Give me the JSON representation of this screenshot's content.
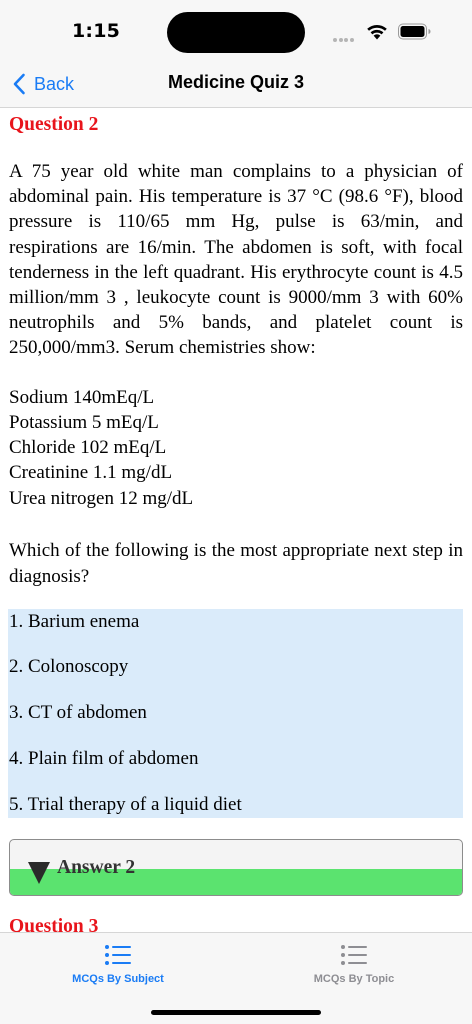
{
  "status_bar": {
    "time": "1:15"
  },
  "nav": {
    "back_label": "Back",
    "title": "Medicine Quiz 3"
  },
  "question": {
    "heading": "Question 2",
    "body": "A 75 year old white man complains to a physician of abdominal pain. His temperature is 37 °C (98.6 °F), blood pressure is 110/65 mm Hg, pulse is 63/min, and respirations are 16/min. The abdomen is soft, with focal tenderness in the left quadrant. His erythrocyte count is 4.5 million/mm 3 , leukocyte count is 9000/mm 3 with 60% neutrophils and 5% bands, and platelet count is 250,000/mm3. Serum chemistries show:",
    "labs": [
      "Sodium 140mEq/L",
      "Potassium 5 mEq/L",
      "Chloride 102 mEq/L",
      "Creatinine 1.1 mg/dL",
      "Urea nitrogen 12 mg/dL"
    ],
    "prompt": "Which of the following is the most appropriate next step in diagnosis?",
    "options": [
      "1. Barium enema",
      "2. Colonoscopy",
      "3. CT of abdomen",
      "4. Plain film of abdomen",
      "5. Trial therapy of a liquid diet"
    ],
    "answer_label": "Answer 2"
  },
  "next_question": {
    "heading": "Question 3"
  },
  "tabs": [
    {
      "label": "MCQs By Subject",
      "active": true
    },
    {
      "label": "MCQs By Topic",
      "active": false
    }
  ],
  "colors": {
    "accent": "#1a7cf5",
    "heading_red": "#e8141b",
    "options_bg": "#daebfa",
    "answer_green": "#5be36f",
    "tab_inactive": "#8e8e93"
  }
}
